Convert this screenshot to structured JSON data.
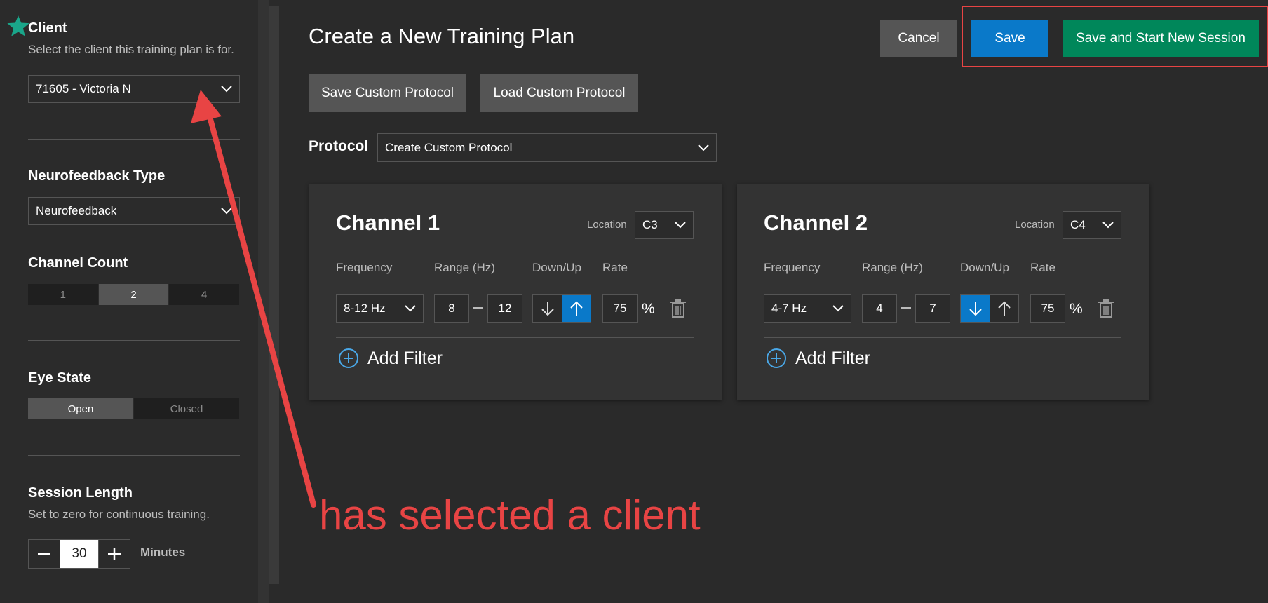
{
  "sidebar": {
    "client": {
      "title": "Client",
      "description": "Select the client this training plan is for.",
      "selected": "71605 - Victoria N"
    },
    "neurofeedback_type": {
      "title": "Neurofeedback Type",
      "selected": "Neurofeedback"
    },
    "channel_count": {
      "title": "Channel Count",
      "options": [
        "1",
        "2",
        "4"
      ],
      "selected": "2"
    },
    "eye_state": {
      "title": "Eye State",
      "options": [
        "Open",
        "Closed"
      ],
      "selected": "Open"
    },
    "session_length": {
      "title": "Session Length",
      "description": "Set to zero for continuous training.",
      "value": "30",
      "unit": "Minutes"
    }
  },
  "header": {
    "title": "Create a New Training Plan",
    "cancel_label": "Cancel",
    "save_label": "Save",
    "save_start_label": "Save and Start New Session"
  },
  "toolbar": {
    "save_custom_label": "Save Custom Protocol",
    "load_custom_label": "Load Custom Protocol"
  },
  "protocol": {
    "label": "Protocol",
    "selected": "Create Custom Protocol"
  },
  "columns": {
    "frequency": "Frequency",
    "range": "Range (Hz)",
    "direction": "Down/Up",
    "rate": "Rate"
  },
  "channels": [
    {
      "title": "Channel 1",
      "location_label": "Location",
      "location": "C3",
      "frequency": "8-12 Hz",
      "range_low": "8",
      "range_high": "12",
      "direction": "up",
      "rate": "75",
      "rate_unit": "%",
      "add_filter_label": "Add Filter"
    },
    {
      "title": "Channel 2",
      "location_label": "Location",
      "location": "C4",
      "frequency": "4-7 Hz",
      "range_low": "4",
      "range_high": "7",
      "direction": "down",
      "rate": "75",
      "rate_unit": "%",
      "add_filter_label": "Add Filter"
    }
  ],
  "annotation": {
    "text": "has selected a client"
  },
  "colors": {
    "accent_blue": "#0a79c9",
    "accent_green": "#00875a",
    "annotation_red": "#e84444",
    "star_teal": "#1aa68a"
  }
}
